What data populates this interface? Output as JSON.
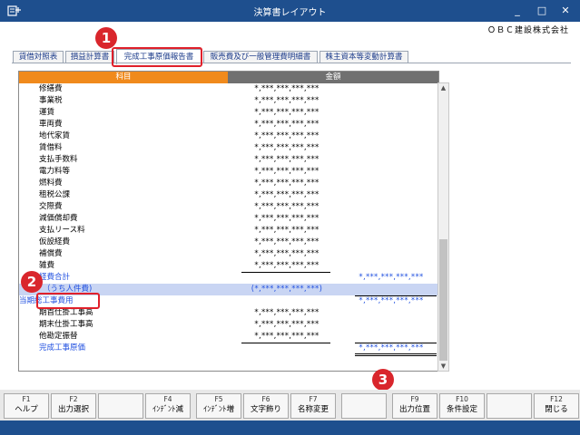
{
  "window": {
    "title": "決算書レイアウト",
    "company": "ＯＢＣ建設株式会社",
    "minimize_glyph": "_",
    "maximize_glyph": "□",
    "close_glyph": "✕"
  },
  "tabs": [
    {
      "label": "貸借対照表"
    },
    {
      "label": "損益計算書"
    },
    {
      "label": "完成工事原価報告書"
    },
    {
      "label": "販売費及び一般管理費明細書"
    },
    {
      "label": "株主資本等変動計算書"
    }
  ],
  "grid": {
    "col_subject": "科目",
    "col_amount": "金額",
    "rows": [
      {
        "name": "修繕費",
        "v1": "*,***,***,***,***",
        "v2": ""
      },
      {
        "name": "事業税",
        "v1": "*,***,***,***,***",
        "v2": ""
      },
      {
        "name": "運賃",
        "v1": "*,***,***,***,***",
        "v2": ""
      },
      {
        "name": "車両費",
        "v1": "*,***,***,***,***",
        "v2": ""
      },
      {
        "name": "地代家賃",
        "v1": "*,***,***,***,***",
        "v2": ""
      },
      {
        "name": "賃借料",
        "v1": "*,***,***,***,***",
        "v2": ""
      },
      {
        "name": "支払手数料",
        "v1": "*,***,***,***,***",
        "v2": ""
      },
      {
        "name": "電力料等",
        "v1": "*,***,***,***,***",
        "v2": ""
      },
      {
        "name": "燃料費",
        "v1": "*,***,***,***,***",
        "v2": ""
      },
      {
        "name": "租税公課",
        "v1": "*,***,***,***,***",
        "v2": ""
      },
      {
        "name": "交際費",
        "v1": "*,***,***,***,***",
        "v2": ""
      },
      {
        "name": "減価償却費",
        "v1": "*,***,***,***,***",
        "v2": ""
      },
      {
        "name": "支払リース料",
        "v1": "*,***,***,***,***",
        "v2": ""
      },
      {
        "name": "仮設経費",
        "v1": "*,***,***,***,***",
        "v2": ""
      },
      {
        "name": "補償費",
        "v1": "*,***,***,***,***",
        "v2": ""
      },
      {
        "name": "雑費",
        "v1": "*,***,***,***,***",
        "v2": ""
      },
      {
        "name": "経費合計",
        "v1": "",
        "v2": "*,***,***,***,***"
      },
      {
        "name": "（うち人件費)",
        "v1": "(*,***,***,***,***)",
        "v2": ""
      },
      {
        "name": "当期総工事費用",
        "v1": "",
        "v2": "*,***,***,***,***"
      },
      {
        "name": "期首仕掛工事高",
        "v1": "*,***,***,***,***",
        "v2": ""
      },
      {
        "name": "期末仕掛工事高",
        "v1": "*,***,***,***,***",
        "v2": ""
      },
      {
        "name": "他勘定振替",
        "v1": "*,***,***,***,***",
        "v2": ""
      },
      {
        "name": "完成工事原価",
        "v1": "",
        "v2": "*,***,***,***,***"
      }
    ]
  },
  "scrollbar": {
    "up_glyph": "▲",
    "down_glyph": "▼"
  },
  "callouts": [
    "1",
    "2",
    "3"
  ],
  "fkeys": [
    {
      "code": "F1",
      "label": "ヘルプ"
    },
    {
      "code": "F2",
      "label": "出力選択"
    },
    {
      "code": "",
      "label": ""
    },
    {
      "code": "F4",
      "label": "ｲﾝﾃﾞﾝﾄ減"
    },
    {
      "code": "F5",
      "label": "ｲﾝﾃﾞﾝﾄ増"
    },
    {
      "code": "F6",
      "label": "文字飾り"
    },
    {
      "code": "F7",
      "label": "名称変更"
    },
    {
      "code": "",
      "label": ""
    },
    {
      "code": "F9",
      "label": "出力位置"
    },
    {
      "code": "F10",
      "label": "条件設定"
    },
    {
      "code": "",
      "label": ""
    },
    {
      "code": "F12",
      "label": "閉じる"
    }
  ],
  "colors": {
    "titlebar": "#1e4f8e",
    "subject_header": "#f08a1c",
    "amount_header": "#707070",
    "selected_row": "#c9d5f3",
    "blue_text": "#2050e0",
    "callout": "#d9262c"
  }
}
